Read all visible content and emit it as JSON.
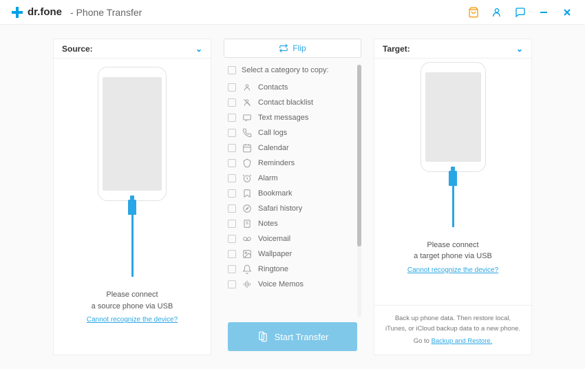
{
  "titlebar": {
    "brand": "dr.fone",
    "module": "- Phone Transfer"
  },
  "source": {
    "label": "Source:",
    "connect_line1": "Please connect",
    "connect_line2": "a source phone via USB",
    "help_link": "Cannot recognize the device?"
  },
  "target": {
    "label": "Target:",
    "connect_line1": "Please connect",
    "connect_line2": "a target phone via USB",
    "help_link": "Cannot recognize the device?",
    "footer_text": "Back up phone data. Then restore local, iTunes, or iCloud backup data to a new phone. Go to ",
    "footer_link": "Backup and Restore."
  },
  "center": {
    "flip_label": "Flip",
    "select_all_label": "Select a category to copy:",
    "categories": [
      "Contacts",
      "Contact blacklist",
      "Text messages",
      "Call logs",
      "Calendar",
      "Reminders",
      "Alarm",
      "Bookmark",
      "Safari history",
      "Notes",
      "Voicemail",
      "Wallpaper",
      "Ringtone",
      "Voice Memos"
    ],
    "start_label": "Start Transfer"
  }
}
